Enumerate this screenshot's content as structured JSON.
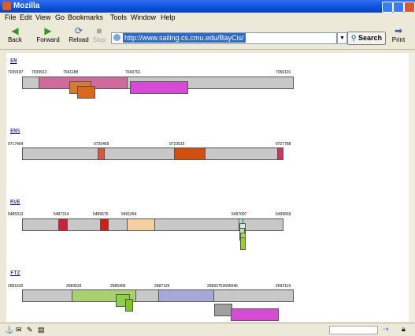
{
  "window": {
    "title": "Mozilla"
  },
  "menu": [
    "File",
    "Edit",
    "View",
    "Go",
    "Bookmarks",
    "Tools",
    "Window",
    "Help"
  ],
  "toolbar": {
    "back": "Back",
    "forward": "Forward",
    "reload": "Reload",
    "stop": "Stop",
    "print": "Print",
    "search": "Search"
  },
  "address": {
    "url": "http://www.sailing.cs.cmu.edu/BayCis/"
  },
  "colors": {
    "title_bar": "#0b4fd6",
    "link": "#0000cc",
    "selection": "#316ac5"
  },
  "genes": [
    {
      "name": "EN",
      "positions": [
        "7039187",
        "7039913",
        "7041188",
        "7043791",
        "7050191"
      ]
    },
    {
      "name": "ENS",
      "positions": [
        "9717464",
        "9720465",
        "9723515",
        "9727788"
      ]
    },
    {
      "name": "RVE",
      "positions": [
        "5485313",
        "5487314",
        "5489575",
        "5491054",
        "5497097",
        "5499669"
      ]
    },
    {
      "name": "FTZ",
      "positions": [
        "2681632",
        "2683633",
        "2685409",
        "2687126",
        "26893752690046",
        "2692119"
      ]
    }
  ]
}
